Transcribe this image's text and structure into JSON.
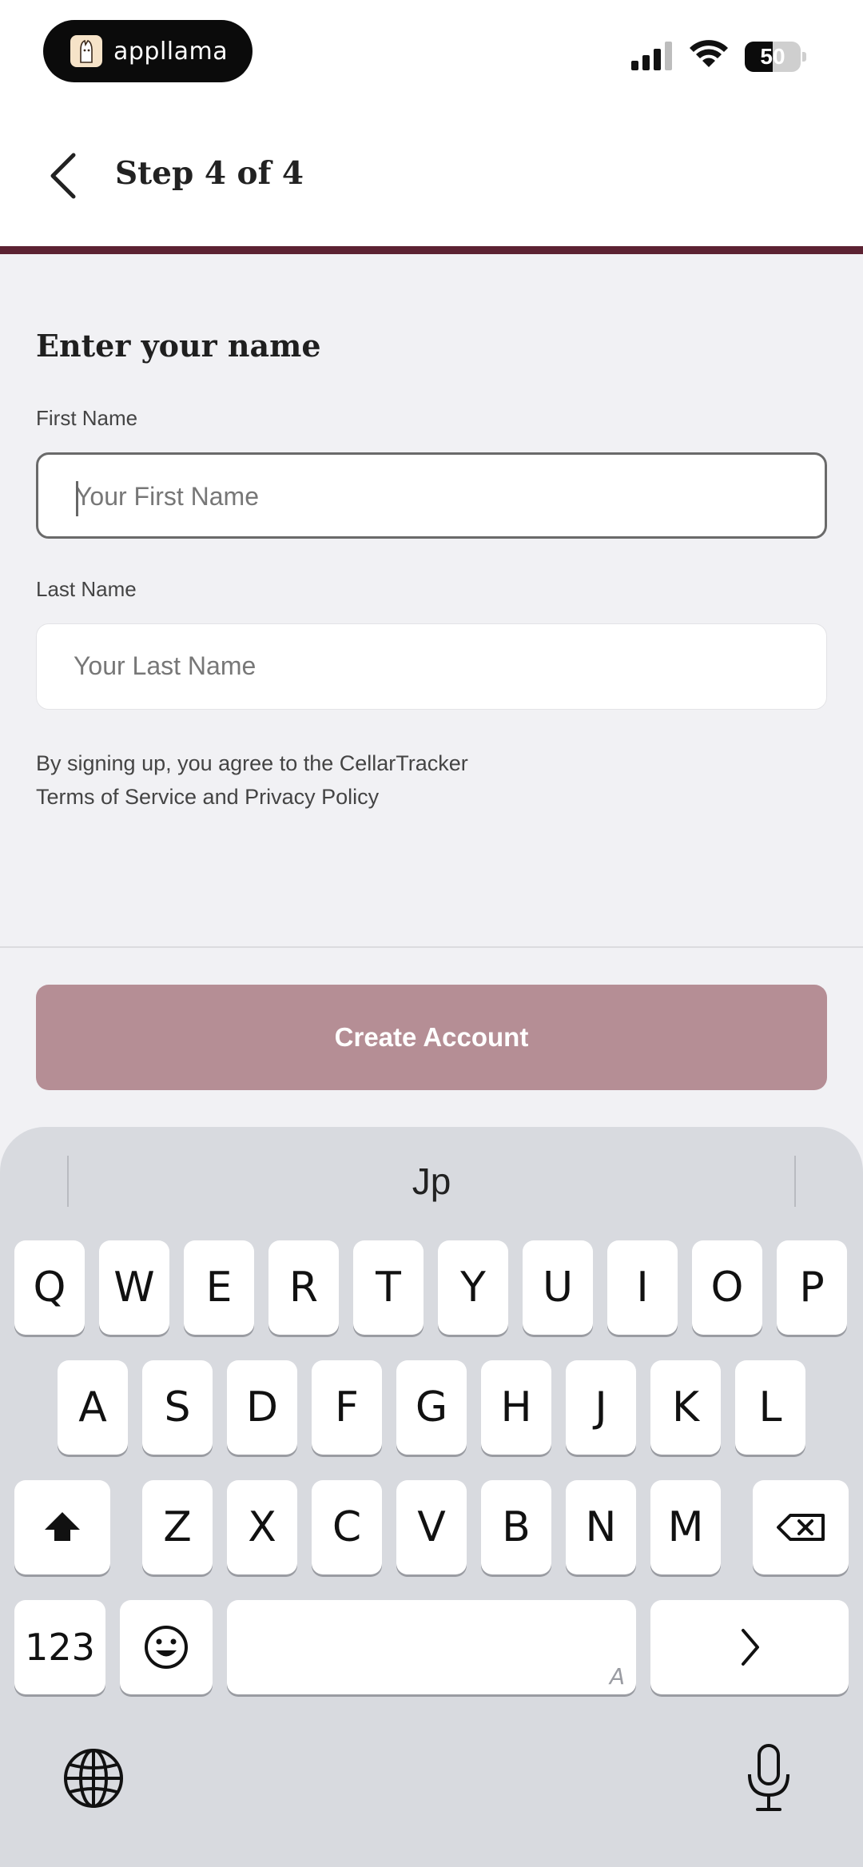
{
  "status_bar": {
    "app_badge": "appllama",
    "battery_level": "50",
    "battery_fraction": 0.5
  },
  "nav": {
    "back_icon": "chevron-left-icon",
    "title": "Step 4 of 4"
  },
  "form": {
    "heading": "Enter your name",
    "first_name_label": "First Name",
    "first_name_placeholder": "Your First Name",
    "last_name_label": "Last Name",
    "last_name_placeholder": "Your Last Name",
    "terms_line1": "By signing up, you agree to the CellarTracker",
    "terms_line2": "Terms of Service and Privacy Policy",
    "submit_label": "Create Account"
  },
  "keyboard": {
    "suggestion": "Jp",
    "row1": [
      "Q",
      "W",
      "E",
      "R",
      "T",
      "Y",
      "U",
      "I",
      "O",
      "P"
    ],
    "row2": [
      "A",
      "S",
      "D",
      "F",
      "G",
      "H",
      "J",
      "K",
      "L"
    ],
    "row3": [
      "Z",
      "X",
      "C",
      "V",
      "B",
      "N",
      "M"
    ],
    "numbers_label": "123",
    "space_hint": "A"
  },
  "colors": {
    "accent": "#5c2232",
    "button_disabled": "#b58e95"
  }
}
